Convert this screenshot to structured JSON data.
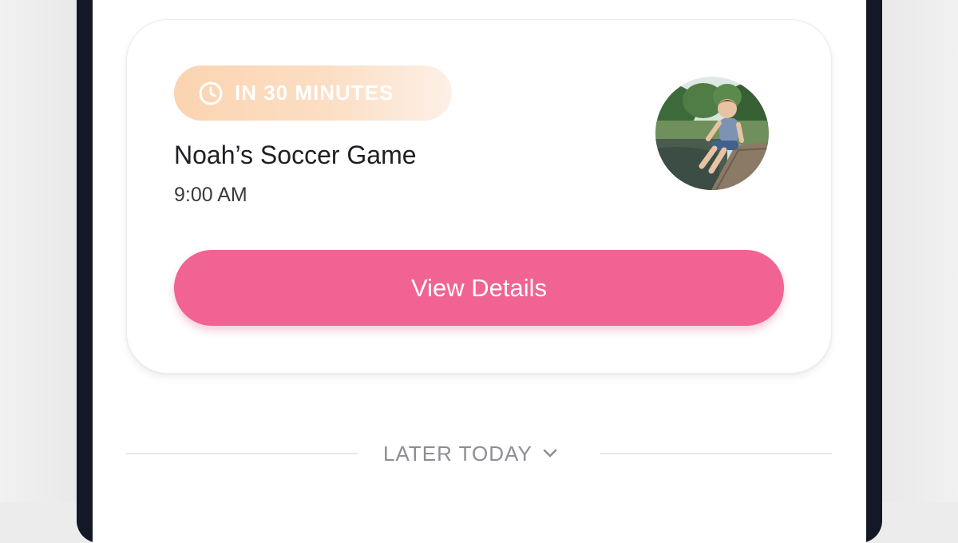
{
  "event_card": {
    "badge_label": "IN 30 MINUTES",
    "badge_icon": "clock-icon",
    "title": "Noah’s Soccer Game",
    "time": "9:00 AM",
    "avatar_icon": "child-photo",
    "view_details_label": "View Details"
  },
  "section": {
    "later_label": "LATER TODAY",
    "later_icon": "chevron-down-icon"
  },
  "colors": {
    "accent_button": "#f06393",
    "badge_start": "#fbd4b1",
    "badge_end": "#fdf0e6",
    "frame": "#141826"
  }
}
